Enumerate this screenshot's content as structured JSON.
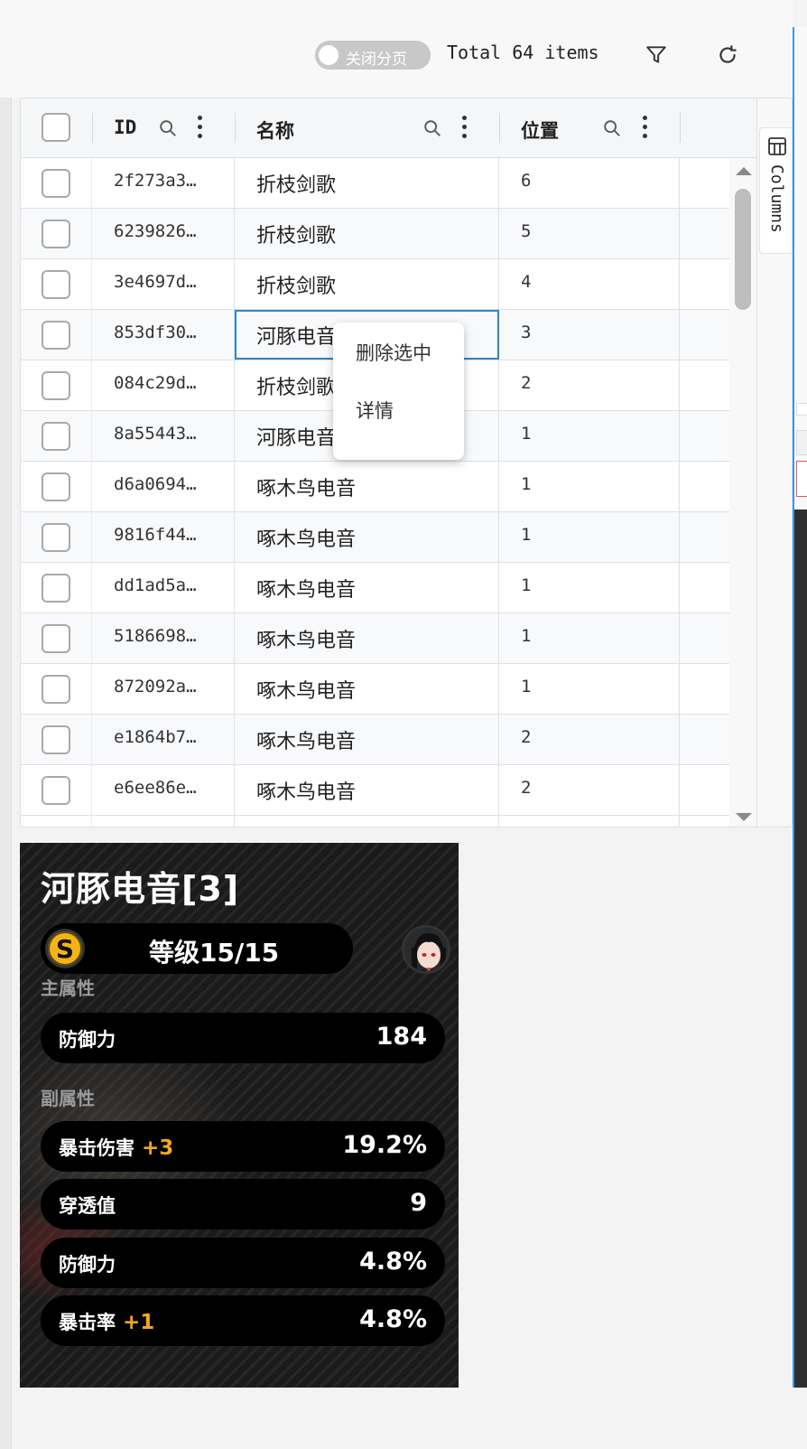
{
  "toolbar": {
    "pagination_toggle_label": "关闭分页",
    "total_text": "Total 64 items",
    "filter_icon": "filter-icon",
    "refresh_icon": "refresh-icon"
  },
  "grid": {
    "columns": [
      {
        "label": "ID"
      },
      {
        "label": "名称"
      },
      {
        "label": "位置"
      }
    ],
    "side_panel_label": "Columns",
    "rows": [
      {
        "id": "2f273a3…",
        "name": "折枝剑歌",
        "pos": "6"
      },
      {
        "id": "6239826…",
        "name": "折枝剑歌",
        "pos": "5"
      },
      {
        "id": "3e4697d…",
        "name": "折枝剑歌",
        "pos": "4"
      },
      {
        "id": "853df30…",
        "name": "河豚电音",
        "pos": "3"
      },
      {
        "id": "084c29d…",
        "name": "折枝剑歌",
        "pos": "2"
      },
      {
        "id": "8a55443…",
        "name": "河豚电音",
        "pos": "1"
      },
      {
        "id": "d6a0694…",
        "name": "啄木鸟电音",
        "pos": "1"
      },
      {
        "id": "9816f44…",
        "name": "啄木鸟电音",
        "pos": "1"
      },
      {
        "id": "dd1ad5a…",
        "name": "啄木鸟电音",
        "pos": "1"
      },
      {
        "id": "5186698…",
        "name": "啄木鸟电音",
        "pos": "1"
      },
      {
        "id": "872092a…",
        "name": "啄木鸟电音",
        "pos": "1"
      },
      {
        "id": "e1864b7…",
        "name": "啄木鸟电音",
        "pos": "2"
      },
      {
        "id": "e6ee86e…",
        "name": "啄木鸟电音",
        "pos": "2"
      }
    ]
  },
  "context_menu": {
    "items": [
      "删除选中",
      "详情"
    ]
  },
  "card": {
    "title": "河豚电音[3]",
    "level_badge": "S",
    "level_text": "等级15/15",
    "main_label": "主属性",
    "main_stat": {
      "name": "防御力",
      "value": "184"
    },
    "sub_label": "副属性",
    "sub_stats": [
      {
        "name": "暴击伤害",
        "bonus": "+3",
        "value": "19.2%"
      },
      {
        "name": "穿透值",
        "bonus": "",
        "value": "9"
      },
      {
        "name": "防御力",
        "bonus": "",
        "value": "4.8%"
      },
      {
        "name": "暴击率",
        "bonus": "+1",
        "value": "4.8%"
      }
    ],
    "colors": {
      "bonus": "#f5a623",
      "coin": "#f5b316"
    }
  }
}
